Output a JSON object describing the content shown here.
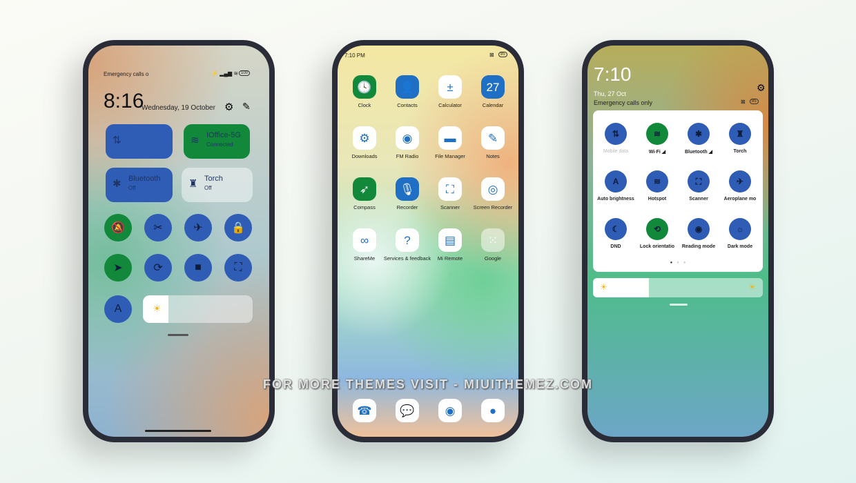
{
  "colors": {
    "blue": "#2f5cb4",
    "green": "#12883a",
    "frame": "#2a2c38"
  },
  "left": {
    "carrier": "Emergency calls o",
    "battery": "100",
    "time": "8:16",
    "date": "Wednesday, 19 October",
    "tiles": [
      {
        "name": "mobile-data",
        "title": "",
        "sub": "",
        "icon": "⇅",
        "color": "#2f5cb4"
      },
      {
        "name": "wifi",
        "title": "IOffice-5G",
        "sub": "Connected",
        "icon": "wifi-icon",
        "color": "#12883a"
      },
      {
        "name": "bluetooth",
        "title": "Bluetooth",
        "sub": "Off",
        "icon": "bluetooth-icon",
        "color": "#2f5cb4"
      },
      {
        "name": "torch",
        "title": "Torch",
        "sub": "Off",
        "icon": "torch-icon",
        "color": "rgba(255,255,255,0.45)"
      }
    ],
    "toggles": [
      {
        "icon": "bell-off",
        "glyph": "🔕",
        "color": "#12883a"
      },
      {
        "icon": "screenshot",
        "glyph": "✂",
        "color": "#2f5cb4"
      },
      {
        "icon": "airplane",
        "glyph": "✈",
        "color": "#2f5cb4"
      },
      {
        "icon": "lock",
        "glyph": "🔒",
        "color": "#2f5cb4"
      },
      {
        "icon": "location",
        "glyph": "➤",
        "color": "#12883a"
      },
      {
        "icon": "rotation-lock",
        "glyph": "⟳",
        "color": "#2f5cb4"
      },
      {
        "icon": "video",
        "glyph": "■",
        "color": "#2f5cb4"
      },
      {
        "icon": "scan",
        "glyph": "⛶",
        "color": "#2f5cb4"
      }
    ],
    "auto_brightness": "A",
    "brightness": 0.23
  },
  "middle": {
    "time": "7:10 PM",
    "battery": "85",
    "apps": [
      {
        "label": "Clock",
        "glyph": "🕓",
        "bg": "#12883a"
      },
      {
        "label": "Contacts",
        "glyph": "👤",
        "bg": "#1f6fc4"
      },
      {
        "label": "Calculator",
        "glyph": "±",
        "bg": "#fff"
      },
      {
        "label": "Calendar",
        "glyph": "27",
        "bg": "#1f6fc4"
      },
      {
        "label": "Downloads",
        "glyph": "⚙",
        "bg": "#fff"
      },
      {
        "label": "FM Radio",
        "glyph": "◉",
        "bg": "#fff"
      },
      {
        "label": "File Manager",
        "glyph": "▬",
        "bg": "#fff"
      },
      {
        "label": "Notes",
        "glyph": "✎",
        "bg": "#fff"
      },
      {
        "label": "Compass",
        "glyph": "➶",
        "bg": "#12883a"
      },
      {
        "label": "Recorder",
        "glyph": "🎙",
        "bg": "#1f6fc4"
      },
      {
        "label": "Scanner",
        "glyph": "⛶",
        "bg": "#fff"
      },
      {
        "label": "Screen Recorder",
        "glyph": "◎",
        "bg": "#fff"
      },
      {
        "label": "ShareMe",
        "glyph": "∞",
        "bg": "#fff"
      },
      {
        "label": "Services & feedback",
        "glyph": "?",
        "bg": "#fff"
      },
      {
        "label": "Mi Remote",
        "glyph": "▤",
        "bg": "#fff"
      },
      {
        "label": "Google",
        "glyph": "⁙",
        "bg": "rgba(255,255,255,0.5)"
      }
    ],
    "dock": [
      {
        "icon": "phone",
        "glyph": "☎"
      },
      {
        "icon": "messages",
        "glyph": "💬"
      },
      {
        "icon": "chrome",
        "glyph": "◉"
      },
      {
        "icon": "camera",
        "glyph": "●"
      }
    ]
  },
  "right": {
    "time": "7:10",
    "date": "Thu, 27 Oct",
    "carrier": "Emergency calls only",
    "battery": "85",
    "tiles": [
      {
        "label": "Mobile data",
        "glyph": "⇅",
        "color": "#2f5cb4",
        "dim": true
      },
      {
        "label": "Wi-Fi ◢",
        "glyph": "≋",
        "color": "#12883a"
      },
      {
        "label": "Bluetooth ◢",
        "glyph": "✱",
        "color": "#2f5cb4"
      },
      {
        "label": "Torch",
        "glyph": "♜",
        "color": "#2f5cb4"
      },
      {
        "label": "Auto brightness",
        "glyph": "A",
        "color": "#2f5cb4"
      },
      {
        "label": "Hotspot",
        "glyph": "≋",
        "color": "#2f5cb4"
      },
      {
        "label": "Scanner",
        "glyph": "⛶",
        "color": "#2f5cb4"
      },
      {
        "label": "Aeroplane mo",
        "glyph": "✈",
        "color": "#2f5cb4"
      },
      {
        "label": "DND",
        "glyph": "☾",
        "color": "#2f5cb4"
      },
      {
        "label": "Lock orientatio",
        "glyph": "⟲",
        "color": "#12883a"
      },
      {
        "label": "Reading mode",
        "glyph": "◉",
        "color": "#2f5cb4"
      },
      {
        "label": "Dark mode",
        "glyph": "☼",
        "color": "#2f5cb4"
      }
    ],
    "page": 1,
    "pages": 3,
    "brightness": 0.33
  },
  "watermark": "FOR MORE THEMES VISIT - MIUITHEMEZ.COM"
}
